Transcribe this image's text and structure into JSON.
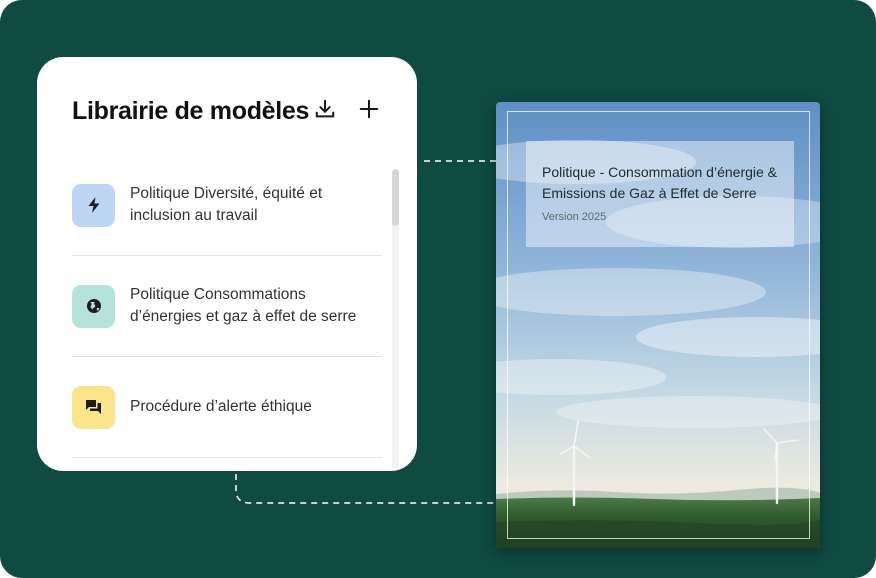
{
  "library": {
    "title": "Librairie de modèles",
    "actions": [
      {
        "icon": "download-icon"
      },
      {
        "icon": "plus-icon"
      }
    ],
    "items": [
      {
        "label": "Politique Diversité, équité et inclusion au travail",
        "icon": "lightning-icon",
        "icon_bg": "#bcd6f3"
      },
      {
        "label": "Politique Consommations d’énergies et gaz à effet de serre",
        "icon": "globe-icon",
        "icon_bg": "#b6e2dc"
      },
      {
        "label": "Procédure d’alerte éthique",
        "icon": "chat-icon",
        "icon_bg": "#fbe58a"
      }
    ]
  },
  "document": {
    "title": "Politique - Consommation d’énergie & Emissions de Gaz à Effet de Serre",
    "version": "Version 2025"
  },
  "colors": {
    "background": "#0f4a43",
    "card": "#ffffff"
  }
}
